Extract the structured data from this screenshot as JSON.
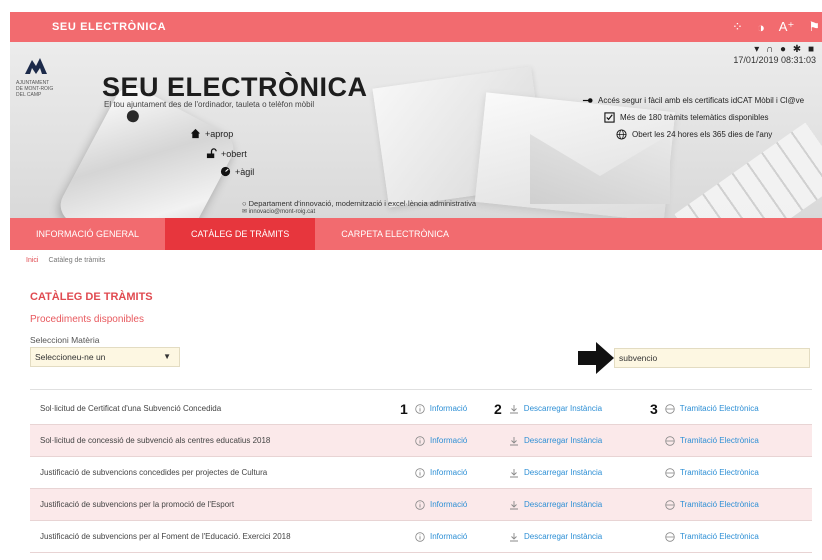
{
  "topbar": {
    "brand": "SEU ELECTRÒNICA",
    "tools": [
      "grid-icon",
      "contrast-icon",
      "font-size-icon",
      "flag-icon"
    ],
    "font_label": "A⁺"
  },
  "hero": {
    "title": "SEU ELECTRÒNICA",
    "subtitle": "El tou ajuntament des de l'ordinador, tauleta o telèfon mòbil",
    "logo_text": "AJUNTAMENT DE MONT-ROIG DEL CAMP",
    "features": [
      "+aprop",
      "+obert",
      "+àgil"
    ],
    "status_icons": "▾ ∩ ● ✱ ■",
    "date": "17/01/2019 08:31:03",
    "claims": [
      "Accés segur i fàcil amb els certificats idCAT Mòbil i Cl@ve",
      "Més de 180 tràmits telemàtics disponibles",
      "Obert les 24 hores els 365 dies de l'any"
    ],
    "dept": "Departament d'innovació, modernització i excel·lència administrativa",
    "email": "innovacio@mont-roig.cat"
  },
  "nav": {
    "tabs": [
      {
        "label": "Informació general",
        "active": false
      },
      {
        "label": "Catàleg de tràmits",
        "active": true
      },
      {
        "label": "Carpeta electrònica",
        "active": false
      }
    ]
  },
  "breadcrumb": {
    "home": "Inici",
    "current": "Catàleg de tràmits"
  },
  "main": {
    "title": "CATÀLEG DE TRÀMITS",
    "subtitle": "Procediments disponibles",
    "select_label": "Seleccioni Matèria",
    "select_value": "Seleccioneu-ne un",
    "search_value": "subvencio"
  },
  "results": {
    "labels": {
      "info": "Informació",
      "download": "Descarregar Instància",
      "electronic": "Tramitació Electrònica"
    },
    "callouts": [
      "1",
      "2",
      "3"
    ],
    "rows": [
      "Sol·licitud de Certificat d'una Subvenció Concedida",
      "Sol·licitud de concessió de subvenció als centres educatius 2018",
      "Justificació de subvencions concedides per projectes de Cultura",
      "Justificació de subvencions per la promoció de l'Esport",
      "Justificació de subvencions per al Foment de l'Educació. Exercici 2018"
    ]
  },
  "colors": {
    "accent": "#f26b6f",
    "active_tab": "#e7363d",
    "link": "#2d8fd5",
    "row_alt": "#fbe9ea"
  }
}
